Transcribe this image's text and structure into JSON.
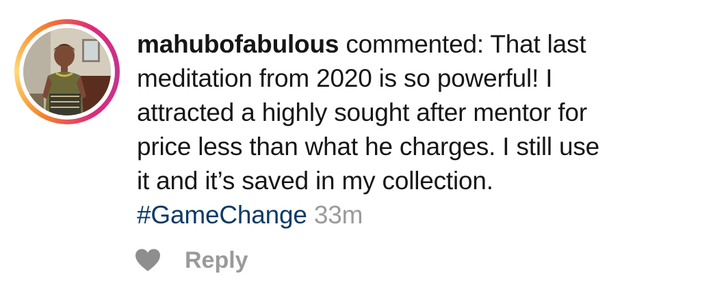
{
  "comment": {
    "username": "mahubofabulous",
    "line1_rest": " commented: That last",
    "line2": "meditation from 2020 is so powerful! I",
    "line3": "attracted a highly sought after mentor for",
    "line4": "price less than what he charges. I still use",
    "line5": "it and it’s saved in my collection.",
    "hashtag": "#GameChange",
    "timestamp": "33m"
  },
  "actions": {
    "like_icon": "heart-icon",
    "reply_label": "Reply"
  },
  "colors": {
    "hashtag": "#0c3a66",
    "muted": "#9a9a9a",
    "ring_start": "#f58529",
    "ring_end": "#dd2a7b"
  }
}
